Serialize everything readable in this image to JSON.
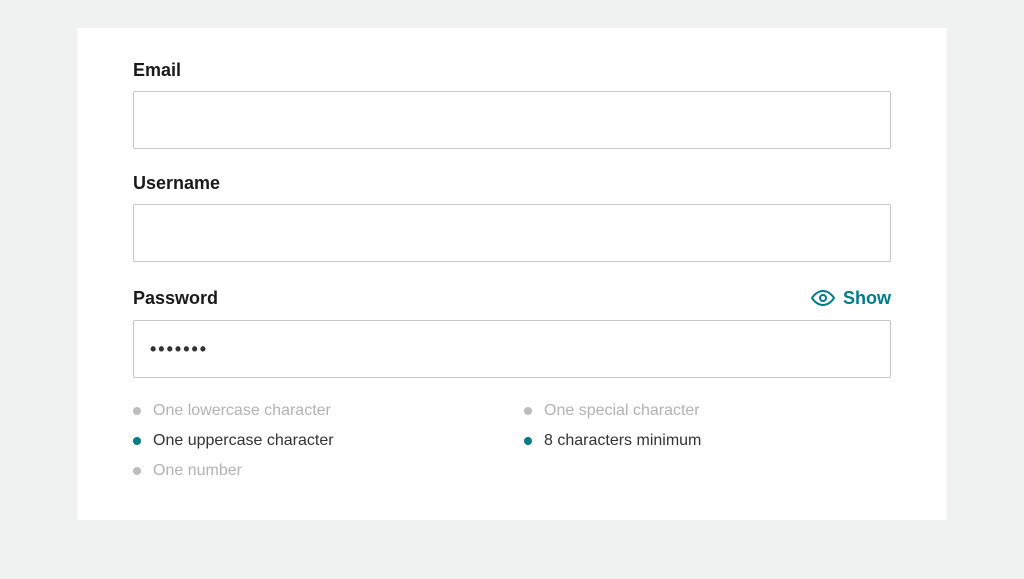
{
  "form": {
    "email": {
      "label": "Email",
      "value": ""
    },
    "username": {
      "label": "Username",
      "value": ""
    },
    "password": {
      "label": "Password",
      "value": "•••••••",
      "show_label": "Show"
    },
    "requirements": [
      {
        "text": "One lowercase character",
        "met": false
      },
      {
        "text": "One special character",
        "met": false
      },
      {
        "text": "One uppercase character",
        "met": true
      },
      {
        "text": "8 characters minimum",
        "met": true
      },
      {
        "text": "One number",
        "met": false
      }
    ]
  },
  "colors": {
    "accent": "#007c89"
  }
}
